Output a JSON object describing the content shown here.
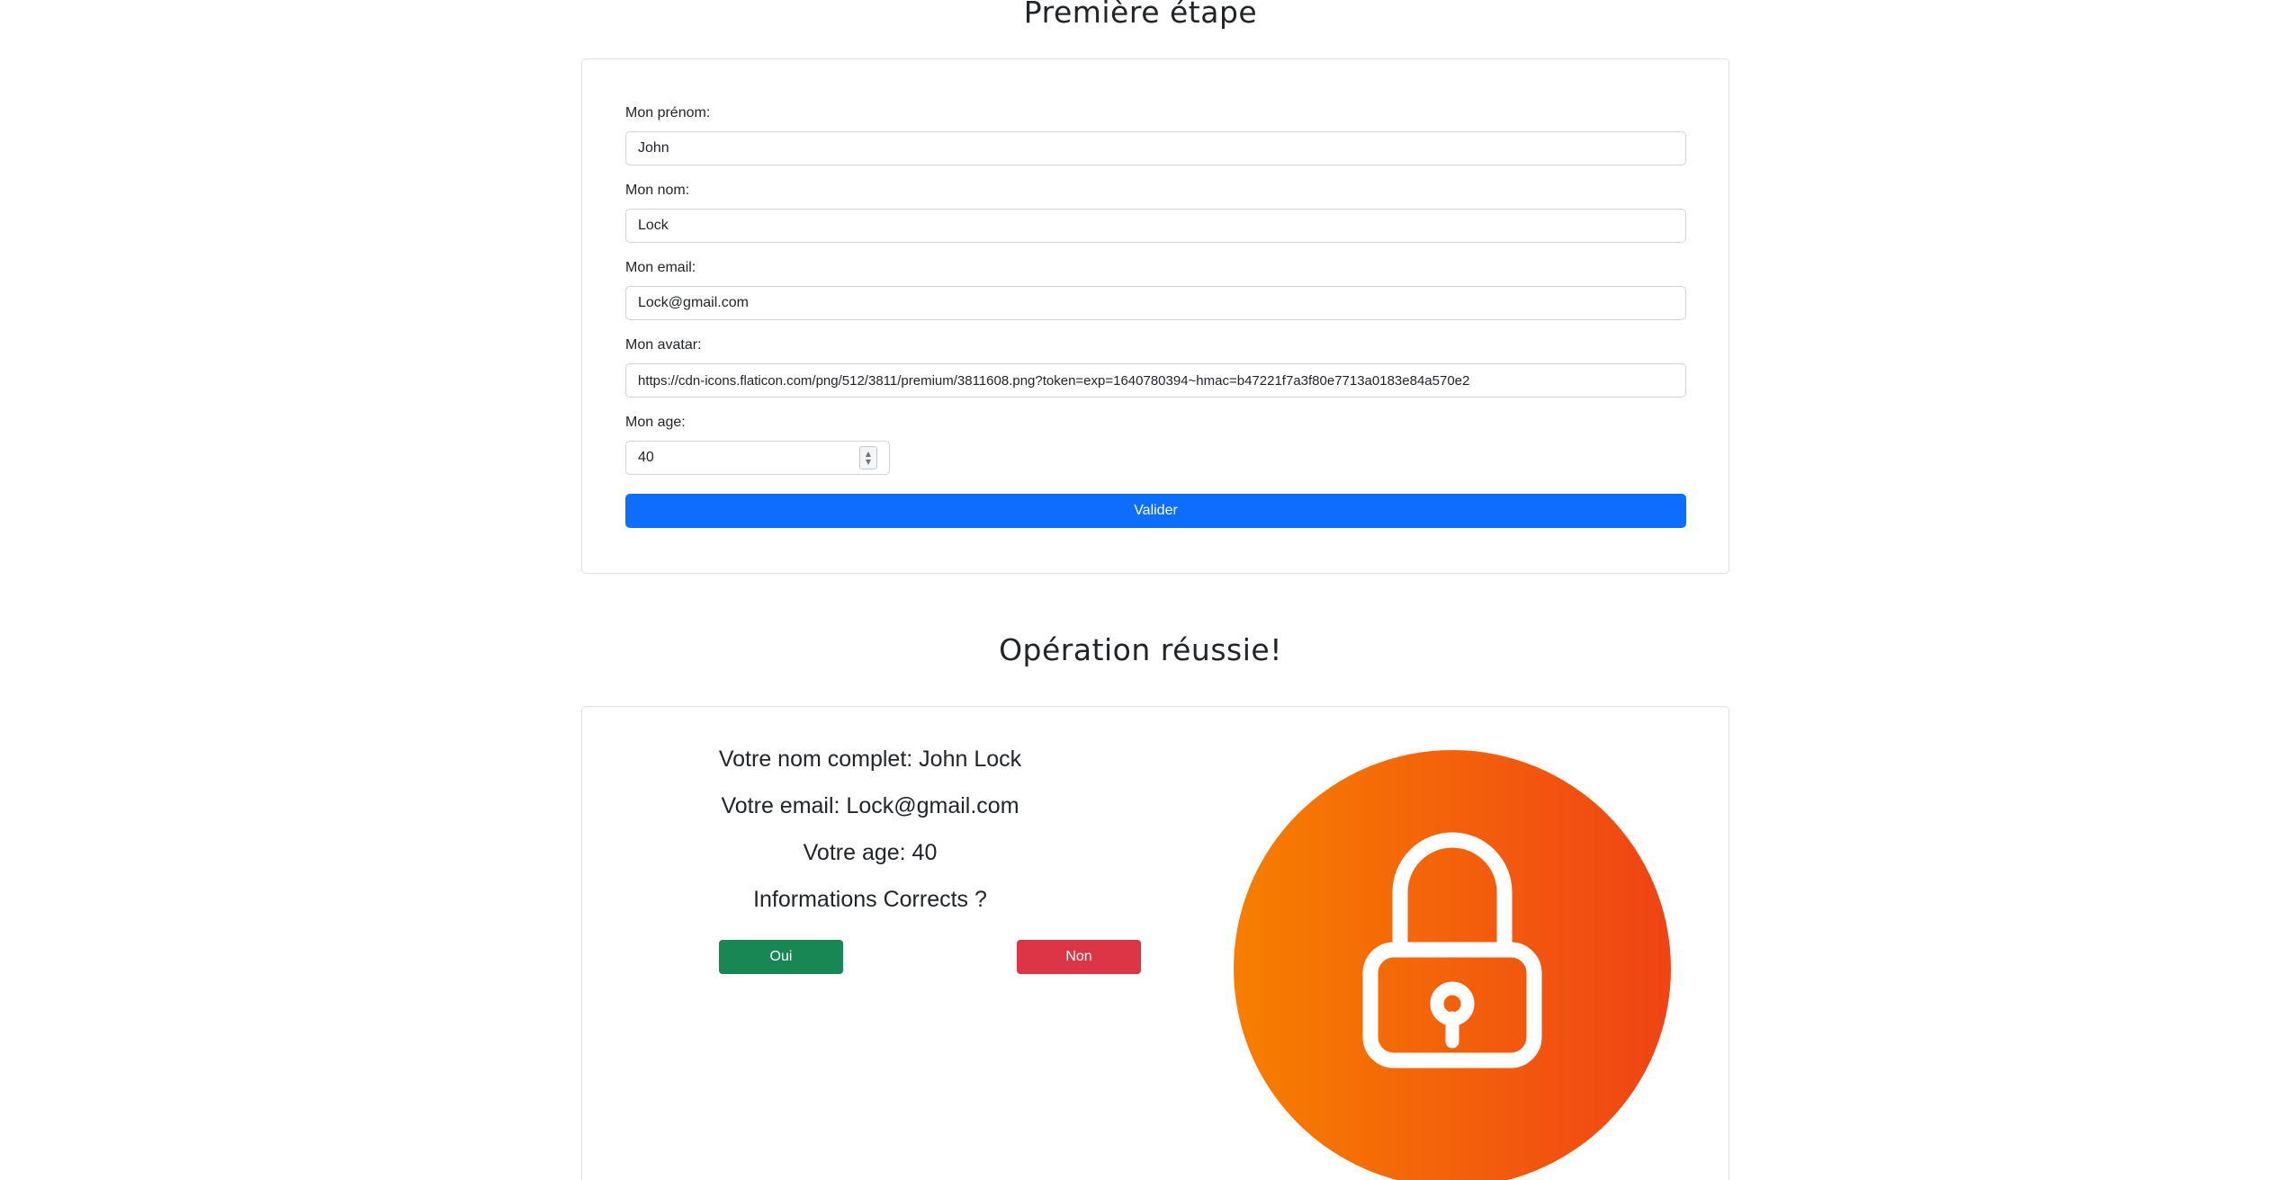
{
  "colors": {
    "primary": "#0d6efd",
    "success": "#198754",
    "danger": "#dc3545",
    "avatar_gradient_start": "#f77f00",
    "avatar_gradient_end": "#f04315"
  },
  "step": {
    "title": "Première étape"
  },
  "form": {
    "firstname_label": "Mon prénom:",
    "firstname_value": "John",
    "lastname_label": "Mon nom:",
    "lastname_value": "Lock",
    "email_label": "Mon email:",
    "email_value": "Lock@gmail.com",
    "avatar_label": "Mon avatar:",
    "avatar_value": "https://cdn-icons.flaticon.com/png/512/3811/premium/3811608.png?token=exp=1640780394~hmac=b47221f7a3f80e7713a0183e84a570e2",
    "age_label": "Mon age:",
    "age_value": "40",
    "submit_label": "Valider"
  },
  "result": {
    "title": "Opération réussie!",
    "fullname_line": "Votre nom complet: John Lock",
    "email_line": "Votre email: Lock@gmail.com",
    "age_line": "Votre age: 40",
    "confirm_question": "Informations Corrects ?",
    "yes_label": "Oui",
    "no_label": "Non",
    "avatar_icon": "padlock-icon"
  }
}
